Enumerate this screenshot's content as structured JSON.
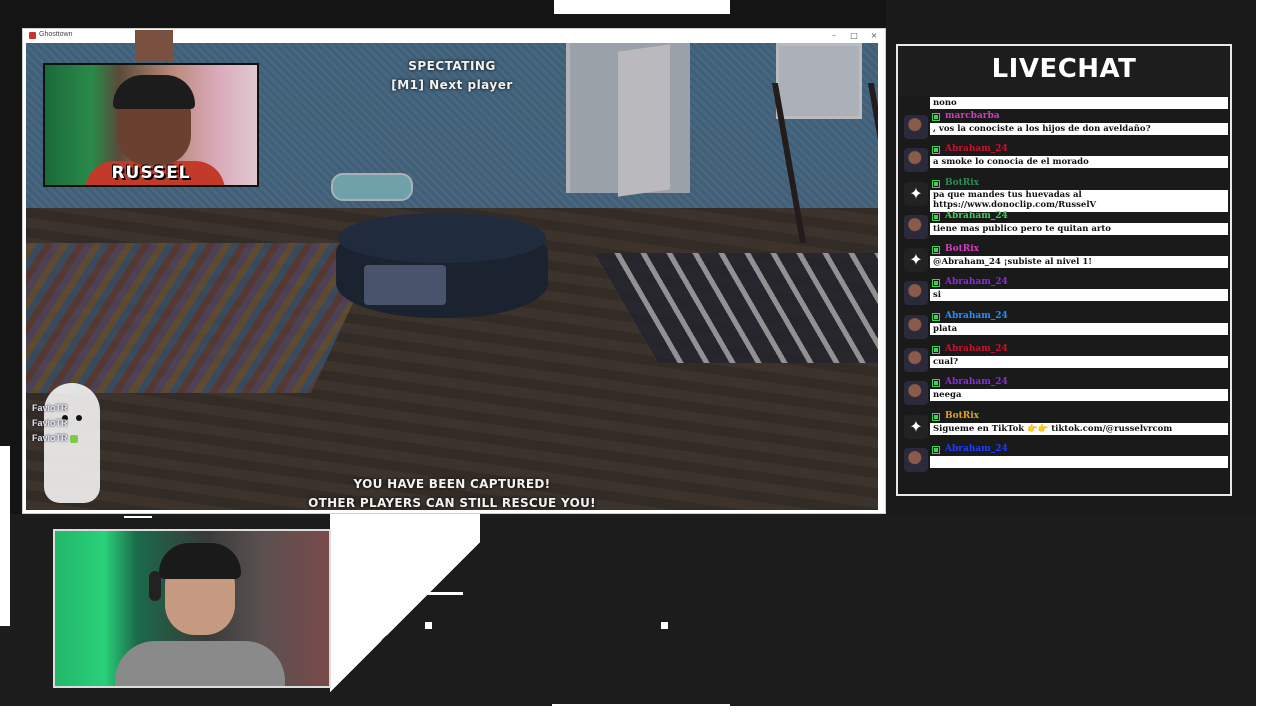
{
  "window": {
    "title": "Ghosttown",
    "minimize_glyph": "–",
    "maximize_glyph": "□",
    "close_glyph": "×"
  },
  "hud": {
    "status": "SPECTATING",
    "hint": "[M1] Next player",
    "captured_line1": "YOU HAVE BEEN CAPTURED!",
    "captured_line2": "OTHER PLAYERS CAN STILL RESCUE YOU!"
  },
  "players": [
    "FavioTR",
    "FavioTR",
    "FavioTR"
  ],
  "webcam_small": {
    "label": "RUSSEL"
  },
  "livechat": {
    "title": "LIVECHAT",
    "messages": [
      {
        "user": "",
        "user_color": "#333333",
        "text": "nono",
        "avatar": "person"
      },
      {
        "user": "marcbarba",
        "user_color": "#d23cc0",
        "text": ", vos la conociste a los hijos de don aveldaño?",
        "avatar": "person"
      },
      {
        "user": "Abraham_24",
        "user_color": "#c8102e",
        "text": "a smoke lo conocia de el morado",
        "avatar": "person"
      },
      {
        "user": "BotRix",
        "user_color": "#2e8b57",
        "text": "pa que mandes tus huevadas al https://www.donoclip.com/RusselV",
        "avatar": "bot"
      },
      {
        "user": "Abraham_24",
        "user_color": "#3ad05a",
        "text": "tiene mas publico pero te quitan arto",
        "avatar": "person"
      },
      {
        "user": "BotRix",
        "user_color": "#d23cc0",
        "text": "@Abraham_24 ¡subiste al nivel 1!",
        "avatar": "bot"
      },
      {
        "user": "Abraham_24",
        "user_color": "#8a2be2",
        "text": "si",
        "avatar": "person"
      },
      {
        "user": "Abraham_24",
        "user_color": "#1e90ff",
        "text": "plata",
        "avatar": "person"
      },
      {
        "user": "Abraham_24",
        "user_color": "#c8102e",
        "text": "cual?",
        "avatar": "person"
      },
      {
        "user": "Abraham_24",
        "user_color": "#8a2be2",
        "text": "neega",
        "avatar": "person"
      },
      {
        "user": "BotRix",
        "user_color": "#daa520",
        "text": "Sigueme en TikTok 👉👉 tiktok.com/@russelvrcom",
        "avatar": "bot"
      },
      {
        "user": "Abraham_24",
        "user_color": "#1e3cff",
        "text": "",
        "avatar": "person"
      }
    ]
  }
}
